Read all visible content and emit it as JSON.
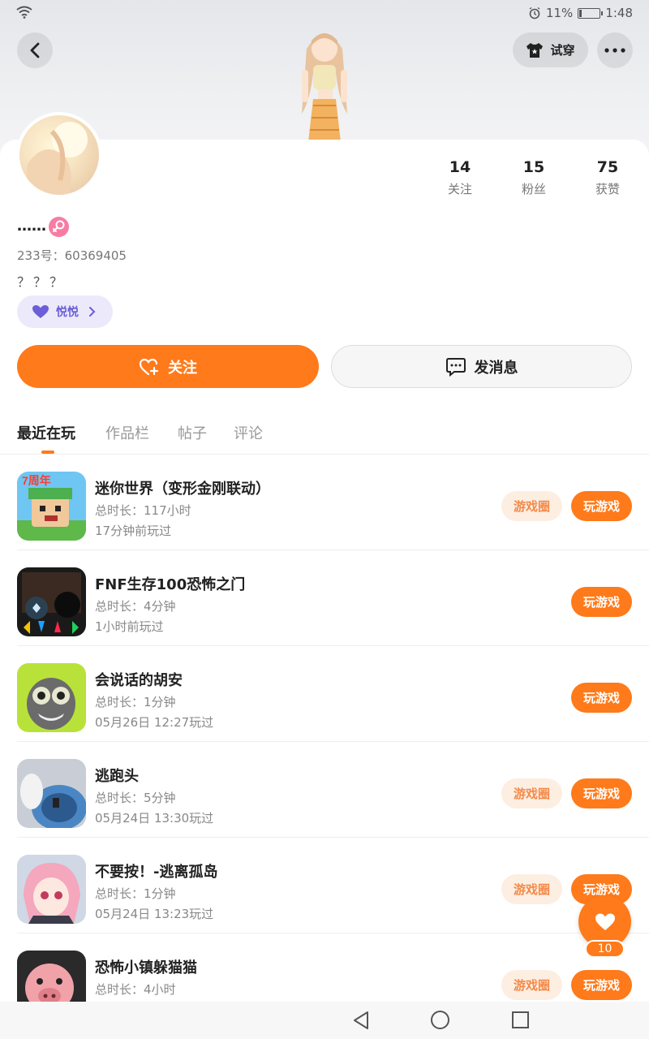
{
  "status_bar": {
    "battery": "11%",
    "time": "1:48"
  },
  "header": {
    "tryon_label": "试穿"
  },
  "profile": {
    "nickname": "……",
    "uid": "233号：60369405",
    "bio": "？？？",
    "tag_label": "悦悦",
    "stats": [
      {
        "value": "14",
        "label": "关注"
      },
      {
        "value": "15",
        "label": "粉丝"
      },
      {
        "value": "75",
        "label": "获赞"
      }
    ],
    "follow_label": "关注",
    "message_label": "发消息"
  },
  "tabs": [
    "最近在玩",
    "作品栏",
    "帖子",
    "评论"
  ],
  "games": [
    {
      "title": "迷你世界（变形金刚联动）",
      "duration": "总时长：117小时",
      "last": "17分钟前玩过",
      "has_circle": true
    },
    {
      "title": "FNF生存100恐怖之门",
      "duration": "总时长：4分钟",
      "last": "1小时前玩过",
      "has_circle": false
    },
    {
      "title": "会说话的胡安",
      "duration": "总时长：1分钟",
      "last": "05月26日 12:27玩过",
      "has_circle": false
    },
    {
      "title": "逃跑头",
      "duration": "总时长：5分钟",
      "last": "05月24日 13:30玩过",
      "has_circle": true
    },
    {
      "title": "不要按！-逃离孤岛",
      "duration": "总时长：1分钟",
      "last": "05月24日 13:23玩过",
      "has_circle": true
    },
    {
      "title": "恐怖小镇躲猫猫",
      "duration": "总时长：4小时",
      "last": "",
      "has_circle": true
    }
  ],
  "game_buttons": {
    "circle_label": "游戏圈",
    "play_label": "玩游戏"
  },
  "floating_like": {
    "count": "10"
  },
  "colors": {
    "accent": "#ff7a1a",
    "circle_bg": "#fdeee2",
    "tag_bg": "#ece9fb"
  }
}
